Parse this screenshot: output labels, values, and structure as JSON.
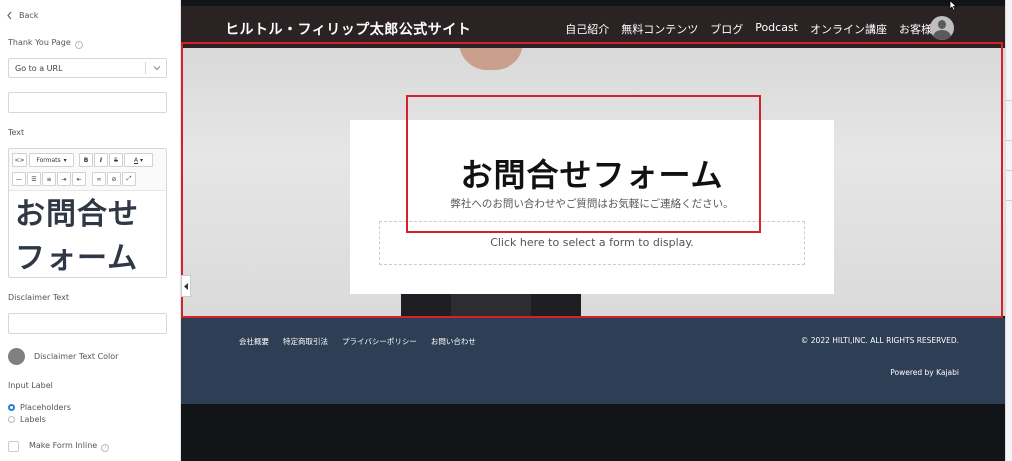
{
  "sidebar": {
    "back_label": "Back",
    "thank_you_label": "Thank You Page",
    "thank_you_select": "Go to a URL",
    "text_label": "Text",
    "formats_label": "Formats",
    "editor_text": "お問合せフォーム",
    "disclaimer_label": "Disclaimer Text",
    "disclaimer_color_label": "Disclaimer Text Color",
    "disclaimer_color": "#808080",
    "input_label_heading": "Input Label",
    "radio_placeholders": "Placeholders",
    "radio_labels": "Labels",
    "selected_input_label": "Placeholders",
    "inline_label": "Make Form Inline"
  },
  "site": {
    "title": "ヒルトル・フィリップ太郎公式サイト",
    "nav": [
      "自己紹介",
      "無料コンテンツ",
      "ブログ",
      "Podcast",
      "オンライン講座",
      "お客様の声"
    ]
  },
  "form": {
    "title": "お問合せフォーム",
    "subtitle": "弊社へのお問い合わせやご質問はお気軽にご連絡ください。",
    "placeholder": "Click here to select a form to display."
  },
  "footer": {
    "links": [
      "会社概要",
      "特定商取引法",
      "プライバシーポリシー",
      "お問い合わせ"
    ],
    "copyright": "© 2022 HILTI,INC. ALL RIGHTS RESERVED.",
    "powered": "Powered by Kajabi"
  },
  "colors": {
    "highlight": "#d4212b",
    "footer_bg": "#2e3e54",
    "header_bg": "#2b2224",
    "radio_accent": "#2a7ad6"
  }
}
